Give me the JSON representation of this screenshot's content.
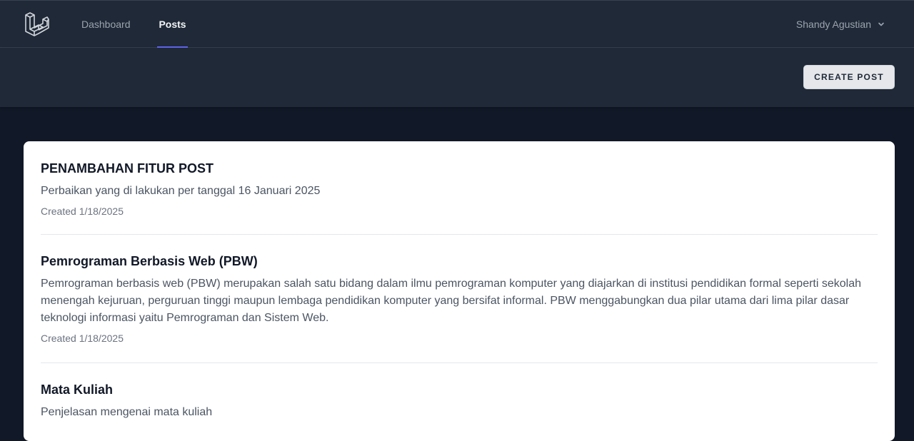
{
  "nav": {
    "logo_icon": "laravel-logo-icon",
    "links": [
      {
        "label": "Dashboard",
        "active": false
      },
      {
        "label": "Posts",
        "active": true
      }
    ],
    "user_name": "Shandy Agustian",
    "accent_color": "#6366f1"
  },
  "header": {
    "create_label": "CREATE POST"
  },
  "posts": [
    {
      "title": "PENAMBAHAN FITUR POST",
      "body": "Perbaikan yang di lakukan per tanggal 16 Januari 2025",
      "created": "Created 1/18/2025"
    },
    {
      "title": "Pemrograman Berbasis Web (PBW)",
      "body": "Pemrograman berbasis web (PBW) merupakan salah satu bidang dalam ilmu pemrograman komputer yang diajarkan di institusi pendidikan formal seperti sekolah menengah kejuruan, perguruan tinggi maupun lembaga pendidikan komputer yang bersifat informal. PBW menggabungkan dua pilar utama dari lima pilar dasar teknologi informasi yaitu Pemrograman dan Sistem Web.",
      "created": "Created 1/18/2025"
    },
    {
      "title": "Mata Kuliah",
      "body": "Penjelasan mengenai mata kuliah",
      "created": ""
    }
  ]
}
